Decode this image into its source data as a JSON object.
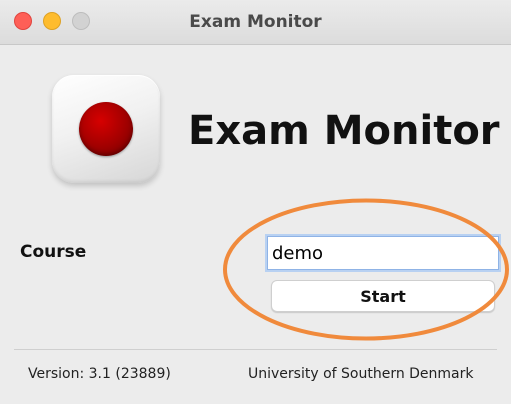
{
  "window": {
    "title": "Exam Monitor"
  },
  "header": {
    "app_icon": "record-icon",
    "app_title": "Exam Monitor"
  },
  "form": {
    "course_label": "Course",
    "course_value": "demo",
    "start_label": "Start"
  },
  "annotation": {
    "highlight_color": "#f08a3c"
  },
  "footer": {
    "version": "Version: 3.1 (23889)",
    "organization": "University of Southern Denmark"
  },
  "colors": {
    "record_red": "#b00000",
    "close": "#fe5f57",
    "minimize": "#febc2e",
    "zoom_disabled": "#d2d2d2"
  }
}
